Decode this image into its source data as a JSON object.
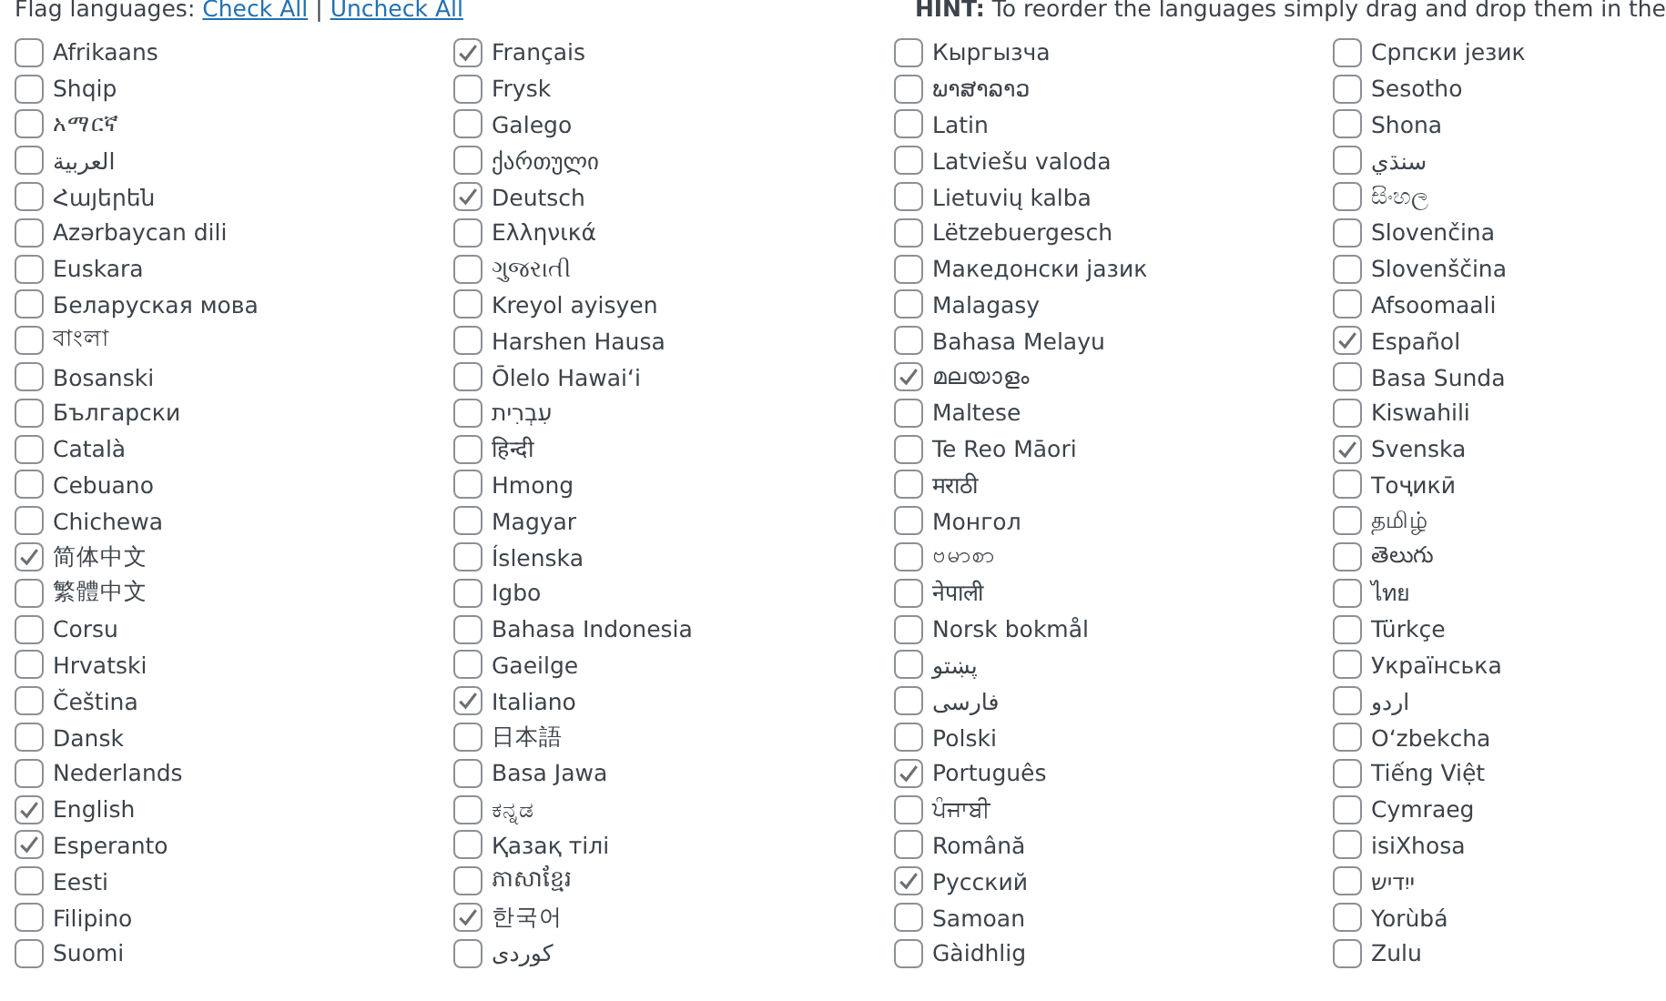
{
  "header": {
    "label": "Flag languages:",
    "links": [
      "Check All",
      "Uncheck All"
    ],
    "separator": "|",
    "hint_label": "HINT:",
    "hint": "To reorder the languages simply drag and drop them in the"
  },
  "columns": [
    [
      {
        "label": "Afrikaans",
        "checked": false
      },
      {
        "label": "Shqip",
        "checked": false
      },
      {
        "label": "አማርኛ",
        "checked": false
      },
      {
        "label": "العربية",
        "checked": false
      },
      {
        "label": "Հայերեն",
        "checked": false
      },
      {
        "label": "Azərbaycan dili",
        "checked": false
      },
      {
        "label": "Euskara",
        "checked": false
      },
      {
        "label": "Беларуская мова",
        "checked": false
      },
      {
        "label": "বাংলা",
        "checked": false
      },
      {
        "label": "Bosanski",
        "checked": false
      },
      {
        "label": "Български",
        "checked": false
      },
      {
        "label": "Català",
        "checked": false
      },
      {
        "label": "Cebuano",
        "checked": false
      },
      {
        "label": "Chichewa",
        "checked": false
      },
      {
        "label": "简体中文",
        "checked": true
      },
      {
        "label": "繁體中文",
        "checked": false
      },
      {
        "label": "Corsu",
        "checked": false
      },
      {
        "label": "Hrvatski",
        "checked": false
      },
      {
        "label": "Čeština",
        "checked": false
      },
      {
        "label": "Dansk",
        "checked": false
      },
      {
        "label": "Nederlands",
        "checked": false
      },
      {
        "label": "English",
        "checked": true
      },
      {
        "label": "Esperanto",
        "checked": true
      },
      {
        "label": "Eesti",
        "checked": false
      },
      {
        "label": "Filipino",
        "checked": false
      },
      {
        "label": "Suomi",
        "checked": false
      }
    ],
    [
      {
        "label": "Français",
        "checked": true
      },
      {
        "label": "Frysk",
        "checked": false
      },
      {
        "label": "Galego",
        "checked": false
      },
      {
        "label": "ქართული",
        "checked": false
      },
      {
        "label": "Deutsch",
        "checked": true
      },
      {
        "label": "Ελληνικά",
        "checked": false
      },
      {
        "label": "ગુજરાતી",
        "checked": false
      },
      {
        "label": "Kreyol ayisyen",
        "checked": false
      },
      {
        "label": "Harshen Hausa",
        "checked": false
      },
      {
        "label": "Ōlelo Hawaiʻi",
        "checked": false
      },
      {
        "label": "עִבְרִית",
        "checked": false
      },
      {
        "label": "हिन्दी",
        "checked": false
      },
      {
        "label": "Hmong",
        "checked": false
      },
      {
        "label": "Magyar",
        "checked": false
      },
      {
        "label": "Íslenska",
        "checked": false
      },
      {
        "label": "Igbo",
        "checked": false
      },
      {
        "label": "Bahasa Indonesia",
        "checked": false
      },
      {
        "label": "Gaeilge",
        "checked": false
      },
      {
        "label": "Italiano",
        "checked": true
      },
      {
        "label": "日本語",
        "checked": false
      },
      {
        "label": "Basa Jawa",
        "checked": false
      },
      {
        "label": "ಕನ್ನಡ",
        "checked": false
      },
      {
        "label": "Қазақ тілі",
        "checked": false
      },
      {
        "label": "ភាសាខ្មែរ",
        "checked": false
      },
      {
        "label": "한국어",
        "checked": true
      },
      {
        "label": "كوردی",
        "checked": false
      }
    ],
    [
      {
        "label": "Кыргызча",
        "checked": false
      },
      {
        "label": "ພາສາລາວ",
        "checked": false
      },
      {
        "label": "Latin",
        "checked": false
      },
      {
        "label": "Latviešu valoda",
        "checked": false
      },
      {
        "label": "Lietuvių kalba",
        "checked": false
      },
      {
        "label": "Lëtzebuergesch",
        "checked": false
      },
      {
        "label": "Македонски јазик",
        "checked": false
      },
      {
        "label": "Malagasy",
        "checked": false
      },
      {
        "label": "Bahasa Melayu",
        "checked": false
      },
      {
        "label": "മലയാളം",
        "checked": true
      },
      {
        "label": "Maltese",
        "checked": false
      },
      {
        "label": "Te Reo Māori",
        "checked": false
      },
      {
        "label": "मराठी",
        "checked": false
      },
      {
        "label": "Монгол",
        "checked": false
      },
      {
        "label": "ဗမာစာ",
        "checked": false
      },
      {
        "label": "नेपाली",
        "checked": false
      },
      {
        "label": "Norsk bokmål",
        "checked": false
      },
      {
        "label": "پښتو",
        "checked": false
      },
      {
        "label": "فارسی",
        "checked": false
      },
      {
        "label": "Polski",
        "checked": false
      },
      {
        "label": "Português",
        "checked": true
      },
      {
        "label": "ਪੰਜਾਬੀ",
        "checked": false
      },
      {
        "label": "Română",
        "checked": false
      },
      {
        "label": "Русский",
        "checked": true
      },
      {
        "label": "Samoan",
        "checked": false
      },
      {
        "label": "Gàidhlig",
        "checked": false
      }
    ],
    [
      {
        "label": "Српски језик",
        "checked": false
      },
      {
        "label": "Sesotho",
        "checked": false
      },
      {
        "label": "Shona",
        "checked": false
      },
      {
        "label": "سنڌي",
        "checked": false
      },
      {
        "label": "සිංහල",
        "checked": false
      },
      {
        "label": "Slovenčina",
        "checked": false
      },
      {
        "label": "Slovenščina",
        "checked": false
      },
      {
        "label": "Afsoomaali",
        "checked": false
      },
      {
        "label": "Español",
        "checked": true
      },
      {
        "label": "Basa Sunda",
        "checked": false
      },
      {
        "label": "Kiswahili",
        "checked": false
      },
      {
        "label": "Svenska",
        "checked": true
      },
      {
        "label": "Тоҷикӣ",
        "checked": false
      },
      {
        "label": "தமிழ்",
        "checked": false
      },
      {
        "label": "తెలుగు",
        "checked": false
      },
      {
        "label": "ไทย",
        "checked": false
      },
      {
        "label": "Türkçe",
        "checked": false
      },
      {
        "label": "Українська",
        "checked": false
      },
      {
        "label": "اردو",
        "checked": false
      },
      {
        "label": "O‘zbekcha",
        "checked": false
      },
      {
        "label": "Tiếng Việt",
        "checked": false
      },
      {
        "label": "Cymraeg",
        "checked": false
      },
      {
        "label": "isiXhosa",
        "checked": false
      },
      {
        "label": "ייִדיש",
        "checked": false
      },
      {
        "label": "Yorùbá",
        "checked": false
      },
      {
        "label": "Zulu",
        "checked": false
      }
    ]
  ]
}
